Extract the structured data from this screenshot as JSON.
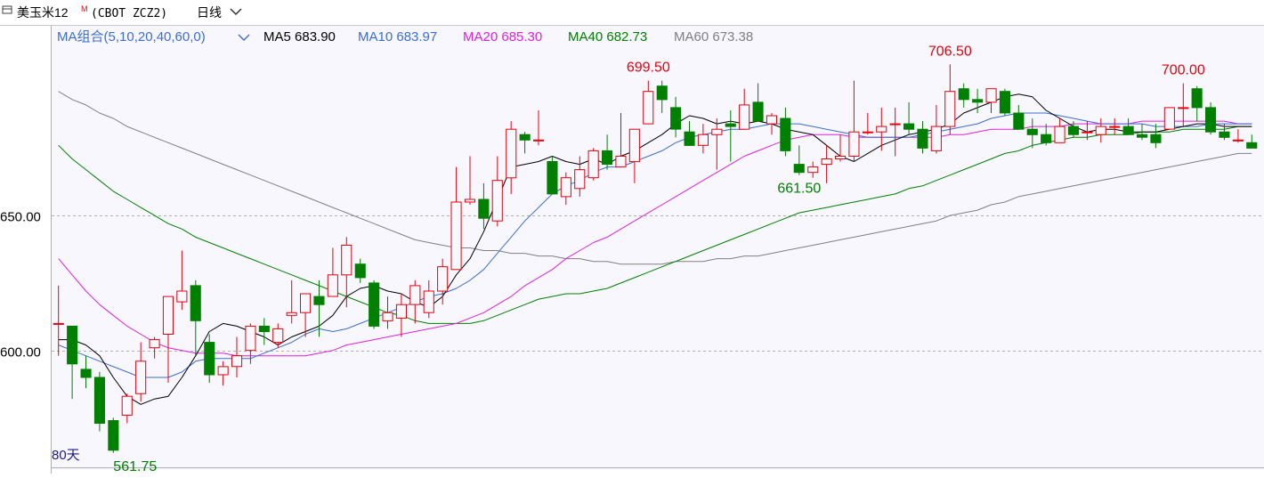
{
  "header": {
    "title": "美玉米12",
    "title_sup": "M",
    "code": "(CBOT ZCZ2)",
    "period": "日线",
    "period_icon": "chevron-down-icon",
    "ma_group_label": "MA组合(5,10,20,40,60,0)",
    "ma_group_icon": "chevron-down-icon",
    "ma5_label": "MA5 683.90",
    "ma10_label": "MA10 683.97",
    "ma20_label": "MA20 685.30",
    "ma40_label": "MA40 682.73",
    "ma60_label": "MA60 673.38"
  },
  "footer": {
    "range_label": "80天"
  },
  "colors": {
    "up": "#e8000b",
    "down": "#008000",
    "ma5": "#000000",
    "ma10": "#3c6ed2",
    "ma20": "#e020e0",
    "ma40": "#008000",
    "ma60": "#808080",
    "grid": "#b0b0b0",
    "plot_bg": "#f7f7fd"
  },
  "chart_data": {
    "type": "candlestick",
    "ylim": [
      557,
      720
    ],
    "yticks": [
      "650.00",
      "600.00"
    ],
    "ytick_values": [
      650,
      600
    ],
    "grid": "dashed horizontal",
    "ohlc": [
      [
        610,
        624,
        598,
        610
      ],
      [
        609,
        608,
        582,
        595
      ],
      [
        593,
        598,
        586,
        590
      ],
      [
        590,
        592,
        570,
        573
      ],
      [
        574,
        575,
        562,
        563
      ],
      [
        576,
        584,
        573,
        583
      ],
      [
        584,
        603,
        581,
        596
      ],
      [
        601,
        605,
        597,
        604
      ],
      [
        606,
        614,
        588,
        620
      ],
      [
        618,
        637,
        615,
        622
      ],
      [
        624,
        626,
        598,
        611
      ],
      [
        603,
        606,
        588,
        591
      ],
      [
        591,
        596,
        587,
        594
      ],
      [
        594,
        605,
        590,
        598
      ],
      [
        600,
        610,
        595,
        609
      ],
      [
        609,
        612,
        602,
        607
      ],
      [
        603,
        610,
        601,
        608
      ],
      [
        613,
        626,
        610,
        614
      ],
      [
        614,
        619,
        605,
        621
      ],
      [
        620,
        626,
        605,
        617
      ],
      [
        620,
        638,
        620,
        628
      ],
      [
        628,
        642,
        616,
        639
      ],
      [
        632,
        634,
        625,
        627
      ],
      [
        625,
        626,
        608,
        609
      ],
      [
        611,
        620,
        608,
        614
      ],
      [
        612,
        621,
        605,
        617
      ],
      [
        617,
        626,
        610,
        624
      ],
      [
        614,
        626,
        612,
        622
      ],
      [
        622,
        634,
        617,
        631
      ],
      [
        630,
        668,
        630,
        655
      ],
      [
        655,
        672,
        654,
        656
      ],
      [
        656,
        662,
        645,
        649
      ],
      [
        648,
        672,
        646,
        663
      ],
      [
        664,
        685,
        658,
        682
      ],
      [
        680,
        681,
        673,
        678
      ],
      [
        678,
        689,
        676,
        678
      ],
      [
        670,
        672,
        658,
        658
      ],
      [
        657,
        666,
        654,
        664
      ],
      [
        660,
        672,
        657,
        667
      ],
      [
        664,
        675,
        663,
        674
      ],
      [
        674,
        680,
        667,
        669
      ],
      [
        668,
        688,
        668,
        672
      ],
      [
        670,
        679,
        662,
        682
      ],
      [
        684,
        700,
        684,
        696
      ],
      [
        698,
        700,
        688,
        693
      ],
      [
        690,
        694,
        679,
        682
      ],
      [
        681,
        685,
        679,
        676
      ],
      [
        676,
        684,
        673,
        680
      ],
      [
        680,
        686,
        667,
        682
      ],
      [
        684,
        689,
        670,
        683
      ],
      [
        682,
        697,
        682,
        691
      ],
      [
        692,
        699,
        686,
        685
      ],
      [
        684,
        688,
        680,
        687
      ],
      [
        686,
        690,
        672,
        674
      ],
      [
        669,
        676,
        665,
        666
      ],
      [
        666,
        670,
        664,
        668
      ],
      [
        669,
        676,
        662,
        671
      ],
      [
        671,
        680,
        670,
        672
      ],
      [
        672,
        700,
        670,
        681
      ],
      [
        681,
        688,
        680,
        681
      ],
      [
        681,
        690,
        674,
        683
      ],
      [
        684,
        690,
        672,
        684
      ],
      [
        684,
        692,
        680,
        682
      ],
      [
        682,
        685,
        673,
        675
      ],
      [
        674,
        691,
        673,
        683
      ],
      [
        683,
        706,
        680,
        696
      ],
      [
        697,
        699,
        690,
        693
      ],
      [
        693,
        697,
        688,
        692
      ],
      [
        692,
        697,
        688,
        697
      ],
      [
        696,
        697,
        687,
        688
      ],
      [
        688,
        691,
        682,
        682
      ],
      [
        682,
        686,
        675,
        680
      ],
      [
        680,
        684,
        676,
        677
      ],
      [
        677,
        686,
        678,
        683
      ],
      [
        683,
        685,
        679,
        680
      ],
      [
        681,
        685,
        678,
        681
      ],
      [
        680,
        686,
        677,
        683
      ],
      [
        683,
        686,
        680,
        683
      ],
      [
        683,
        686,
        680,
        680
      ],
      [
        680,
        684,
        678,
        679
      ],
      [
        680,
        684,
        675,
        677
      ],
      [
        682,
        690,
        682,
        690
      ],
      [
        690,
        699,
        683,
        690
      ],
      [
        697,
        698,
        685,
        690
      ],
      [
        690,
        692,
        680,
        681
      ],
      [
        681,
        684,
        678,
        679
      ],
      [
        678,
        682,
        677,
        678
      ],
      [
        677,
        680,
        675,
        675
      ]
    ],
    "ma_lines": [
      {
        "name": "MA5",
        "values": [
          604,
          604,
          602,
          598,
          590,
          583,
          580,
          582,
          583,
          590,
          598,
          607,
          610,
          609,
          607,
          605,
          602,
          605,
          607,
          609,
          613,
          620,
          623,
          624,
          622,
          621,
          618,
          616,
          620,
          628,
          634,
          644,
          656,
          668,
          669,
          670,
          672,
          670,
          669,
          671,
          669,
          672,
          674,
          677,
          680,
          684,
          687,
          686,
          684,
          685,
          684,
          685,
          684,
          682,
          681,
          680,
          676,
          672,
          670,
          673,
          676,
          678,
          680,
          681,
          682,
          684,
          688,
          690,
          692,
          694,
          695,
          694,
          689,
          686,
          683,
          681,
          682,
          682,
          681,
          681,
          681,
          682,
          683,
          684,
          684,
          683,
          683,
          683
        ]
      },
      {
        "name": "MA10",
        "values": [
          602,
          600,
          598,
          596,
          594,
          592,
          590,
          590,
          590,
          592,
          596,
          597,
          597,
          597,
          597,
          599,
          601,
          603,
          606,
          608,
          607,
          608,
          610,
          612,
          614,
          616,
          618,
          620,
          621,
          623,
          626,
          630,
          636,
          642,
          648,
          653,
          658,
          661,
          663,
          666,
          668,
          668,
          670,
          672,
          674,
          677,
          679,
          680,
          681,
          682,
          682,
          683,
          684,
          684,
          684,
          683,
          682,
          681,
          680,
          679,
          679,
          679,
          679,
          680,
          681,
          682,
          683,
          684,
          686,
          687,
          688,
          688,
          688,
          687,
          686,
          685,
          684,
          684,
          684,
          684,
          683,
          683,
          683,
          683,
          684,
          684,
          684,
          684
        ]
      },
      {
        "name": "MA20",
        "values": [
          634,
          628,
          622,
          617,
          613,
          609,
          606,
          603,
          601,
          600,
          599,
          599,
          599,
          598,
          598,
          598,
          598,
          598,
          598,
          599,
          600,
          602,
          603,
          604,
          605,
          606,
          607,
          608,
          609,
          610,
          612,
          614,
          617,
          620,
          624,
          627,
          630,
          634,
          637,
          640,
          642,
          645,
          648,
          651,
          654,
          657,
          660,
          663,
          666,
          669,
          672,
          674,
          676,
          678,
          679,
          680,
          680,
          680,
          679,
          679,
          679,
          679,
          679,
          679,
          679,
          680,
          680,
          681,
          682,
          682,
          682,
          683,
          683,
          683,
          684,
          684,
          684,
          684,
          684,
          685,
          685,
          685,
          685,
          685,
          685,
          685,
          684,
          684
        ]
      },
      {
        "name": "MA40",
        "values": [
          676,
          671,
          667,
          663,
          659,
          656,
          653,
          650,
          647,
          645,
          642,
          640,
          638,
          636,
          634,
          632,
          630,
          628,
          626,
          624,
          622,
          620,
          618,
          616,
          614,
          613,
          611,
          610,
          610,
          610,
          610,
          611,
          613,
          615,
          617,
          619,
          620,
          621,
          621,
          622,
          623,
          625,
          627,
          629,
          631,
          633,
          635,
          637,
          639,
          641,
          643,
          645,
          647,
          649,
          651,
          652,
          653,
          654,
          655,
          656,
          657,
          658,
          660,
          661,
          663,
          665,
          667,
          669,
          671,
          673,
          674,
          676,
          677,
          678,
          679,
          679,
          680,
          680,
          680,
          681,
          681,
          681,
          682,
          682,
          682,
          682,
          683,
          683
        ]
      },
      {
        "name": "MA60",
        "values": [
          696,
          693,
          691,
          688,
          686,
          683,
          681,
          679,
          677,
          675,
          673,
          671,
          669,
          667,
          665,
          663,
          661,
          659,
          657,
          655,
          653,
          651,
          649,
          647,
          645,
          643,
          641,
          640,
          639,
          638,
          638,
          637,
          637,
          636,
          636,
          635,
          635,
          634,
          634,
          633,
          633,
          632,
          632,
          632,
          632,
          633,
          633,
          633,
          634,
          634,
          635,
          635,
          636,
          637,
          638,
          639,
          640,
          641,
          642,
          643,
          644,
          645,
          646,
          647,
          648,
          650,
          651,
          652,
          654,
          655,
          657,
          658,
          659,
          660,
          661,
          662,
          663,
          664,
          665,
          666,
          667,
          668,
          669,
          670,
          671,
          672,
          673,
          673
        ]
      }
    ],
    "annotations": [
      {
        "text": "699.50",
        "index": 43,
        "kind": "high"
      },
      {
        "text": "706.50",
        "index": 65,
        "kind": "high"
      },
      {
        "text": "700.00",
        "index": 82,
        "kind": "high"
      },
      {
        "text": "661.50",
        "index": 54,
        "kind": "low"
      },
      {
        "text": "561.75",
        "index": 4,
        "kind": "low"
      }
    ]
  }
}
